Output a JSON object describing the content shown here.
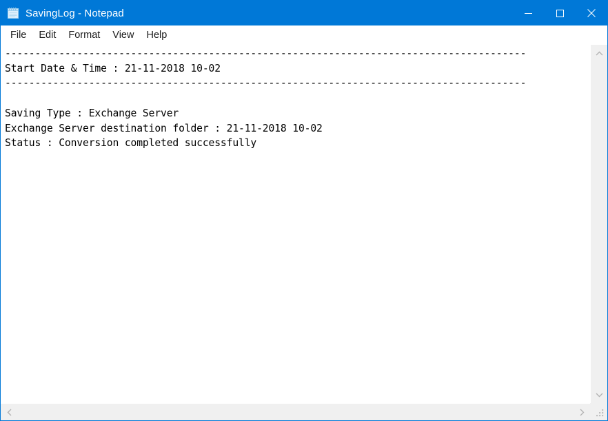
{
  "window": {
    "title": "SavingLog - Notepad",
    "icon": "notepad-icon",
    "accent_color": "#0078d7",
    "controls": {
      "minimize": "minimize-icon",
      "maximize": "maximize-icon",
      "close": "close-icon"
    }
  },
  "menubar": {
    "items": [
      {
        "label": "File"
      },
      {
        "label": "Edit"
      },
      {
        "label": "Format"
      },
      {
        "label": "View"
      },
      {
        "label": "Help"
      }
    ]
  },
  "document": {
    "content": "---------------------------------------------------------------------------------------\nStart Date & Time : 21-11-2018 10-02\n---------------------------------------------------------------------------------------\n\nSaving Type : Exchange Server\nExchange Server destination folder : 21-11-2018 10-02\nStatus : Conversion completed successfully",
    "lines": [
      "---------------------------------------------------------------------------------------",
      "Start Date & Time : 21-11-2018 10-02",
      "---------------------------------------------------------------------------------------",
      "",
      "Saving Type : Exchange Server",
      "Exchange Server destination folder : 21-11-2018 10-02",
      "Status : Conversion completed successfully"
    ],
    "fields": {
      "start_date_time_label": "Start Date & Time",
      "start_date_time_value": "21-11-2018 10-02",
      "saving_type_label": "Saving Type",
      "saving_type_value": "Exchange Server",
      "destination_folder_label": "Exchange Server destination folder",
      "destination_folder_value": "21-11-2018 10-02",
      "status_label": "Status",
      "status_value": "Conversion completed successfully"
    }
  },
  "scrollbars": {
    "vertical": {
      "up": "chevron-up-icon",
      "down": "chevron-down-icon"
    },
    "horizontal": {
      "left": "chevron-left-icon",
      "right": "chevron-right-icon"
    },
    "resize_grip": "resize-grip-icon"
  }
}
